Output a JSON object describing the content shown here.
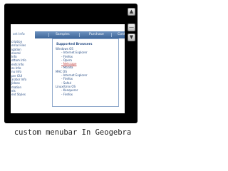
{
  "window": {
    "controls": [
      "▲",
      "—",
      "▼"
    ]
  },
  "menubar": {
    "items": [
      {
        "label": "ort Info",
        "active": true
      },
      {
        "label": "Samples",
        "active": false
      },
      {
        "label": "Purchase",
        "active": false
      },
      {
        "label": "Contac",
        "active": false
      }
    ]
  },
  "sidebar": {
    "items": [
      "cription",
      "ernal Files",
      "igation",
      "eneral",
      "Info",
      "ottom Info",
      "ents Info",
      "es Info",
      "nu Info",
      "per GUI",
      "arator Info",
      "Jideos",
      "mation",
      "els",
      "ent Styles"
    ]
  },
  "dropdown": {
    "heading": "Supported Browsers",
    "items": [
      {
        "label": "Windows OS",
        "level": 1
      },
      {
        "label": "Internet Explorer",
        "level": 2
      },
      {
        "label": "Firefox",
        "level": 2
      },
      {
        "label": "Opera",
        "level": 2
      },
      {
        "label": "Netscape",
        "level": 2,
        "highlight": true
      },
      {
        "label": "Mozilla",
        "level": 2
      },
      {
        "label": "MAC OS",
        "level": 1
      },
      {
        "label": "Internet Explorer",
        "level": 2
      },
      {
        "label": "Firefox",
        "level": 2
      },
      {
        "label": "Safari",
        "level": 2
      },
      {
        "label": "Linux/Unix OS",
        "level": 1
      },
      {
        "label": "Konqueror",
        "level": 2
      },
      {
        "label": "Firefox",
        "level": 2
      }
    ]
  },
  "caption": "custom menubar In Geogebra"
}
